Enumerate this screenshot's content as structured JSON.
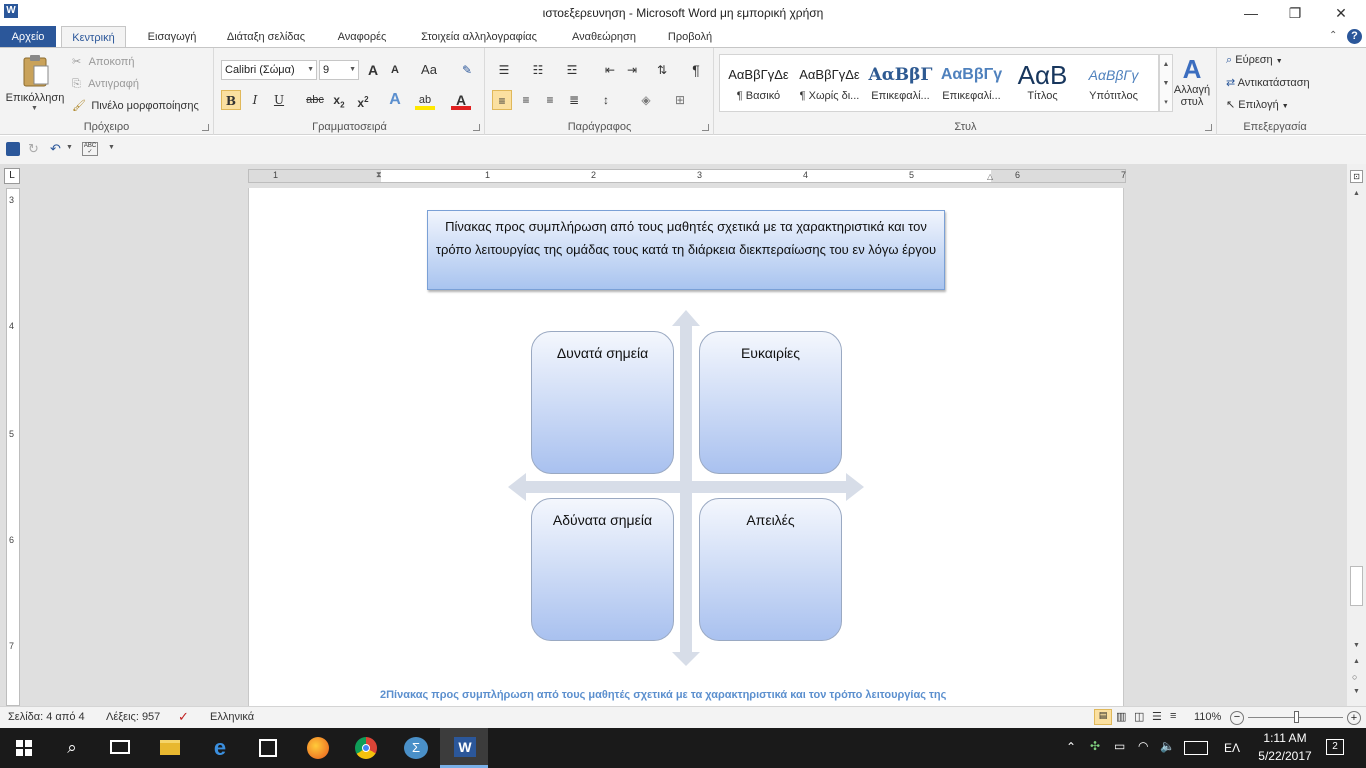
{
  "window": {
    "title": "ιστοεξερευνηση  -  Microsoft Word μη εμπορική χρήση",
    "controls": {
      "minimize": "—",
      "restore": "❐",
      "close": "✕"
    }
  },
  "tabs": [
    "Αρχείο",
    "Κεντρική",
    "Εισαγωγή",
    "Διάταξη σελίδας",
    "Αναφορές",
    "Στοιχεία αλληλογραφίας",
    "Αναθεώρηση",
    "Προβολή"
  ],
  "ribbon": {
    "clipboard": {
      "paste_label": "Επικόλληση",
      "cut_label": "Αποκοπή",
      "copy_label": "Αντιγραφή",
      "format_painter_label": "Πινέλο μορφοποίησης",
      "group_label": "Πρόχειρο"
    },
    "font": {
      "font_name": "Calibri (Σώμα)",
      "font_size": "9",
      "grow": "A",
      "shrink": "A",
      "change_case": "Aa",
      "bold": "B",
      "italic": "I",
      "underline": "U",
      "strike": "abc",
      "subscript": "x",
      "sub_index": "2",
      "superscript": "x",
      "sup_index": "2",
      "text_effects": "A",
      "highlight": "ab",
      "font_color": "A",
      "group_label": "Γραμματοσειρά"
    },
    "paragraph": {
      "pilcrow": "¶",
      "group_label": "Παράγραφος"
    },
    "styles": {
      "items": [
        {
          "preview": "ΑαΒβΓγΔε",
          "name": "¶ Βασικό"
        },
        {
          "preview": "ΑαΒβΓγΔε",
          "name": "¶ Χωρίς δι..."
        },
        {
          "preview": "ΑαΒβΓ",
          "name": "Επικεφαλί..."
        },
        {
          "preview": "ΑαΒβΓγ",
          "name": "Επικεφαλί..."
        },
        {
          "preview": "ΑαΒ",
          "name": "Τίτλος"
        },
        {
          "preview": "ΑαΒβΓγ",
          "name": "Υπότιτλος"
        }
      ],
      "change_styles_line1": "Αλλαγή",
      "change_styles_line2": "στυλ",
      "group_label": "Στυλ"
    },
    "editing": {
      "find_label": "Εύρεση",
      "replace_label": "Αντικατάσταση",
      "select_label": "Επιλογή",
      "group_label": "Επεξεργασία"
    }
  },
  "ruler": {
    "h_numbers": [
      "1",
      "1",
      "2",
      "3",
      "4",
      "5",
      "6",
      "7"
    ],
    "v_numbers": [
      "3",
      "4",
      "5",
      "6",
      "7"
    ],
    "tab_marker": "L"
  },
  "document": {
    "heading_box": "Πίνακας προς συμπλήρωση από τους μαθητές σχετικά με τα χαρακτηριστικά και τον τρόπο λειτουργίας της ομάδας τους κατά τη διάρκεια διεκπεραίωσης του εν λόγω έργου",
    "quadrants": [
      "Δυνατά σημεία",
      "Ευκαιρίες",
      "Αδύνατα σημεία",
      "Απειλές"
    ],
    "caption": "2Πίνακας προς συμπλήρωση  από τους μαθητές σχετικά με τα χαρακτηριστικά και τον τρόπο λειτουργίας της"
  },
  "statusbar": {
    "page": "Σελίδα: 4 από 4",
    "words": "Λέξεις: 957",
    "language": "Ελληνικά",
    "zoom": "110%"
  },
  "taskbar": {
    "time": "1:11 AM",
    "date": "5/22/2017",
    "lang": "ΕΛ",
    "notifications": "2"
  },
  "colors": {
    "accent": "#2b579a",
    "quadrant_fill": "#a9c1ef",
    "caption": "#5b8fce"
  }
}
